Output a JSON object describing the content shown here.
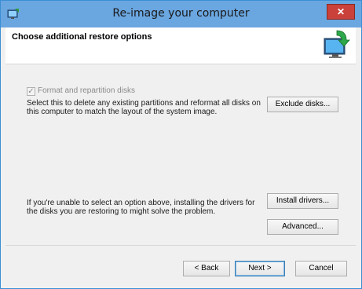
{
  "window": {
    "title": "Re-image your computer",
    "close_label": "✕",
    "title_icon": "restore-computer-icon",
    "colors": {
      "titlebar": "#6aa6e0",
      "close": "#c9413a",
      "border": "#3a8fd6"
    }
  },
  "header": {
    "title": "Choose additional restore options",
    "icon": "computer-restore-icon"
  },
  "options": {
    "format_label": "Format and repartition disks",
    "format_checked": true,
    "format_description": "Select this to delete any existing partitions and reformat all disks on this computer to match the layout of the system image.",
    "exclude_button": "Exclude disks...",
    "drivers_description": "If you're unable to select an option above, installing the drivers for the disks you are restoring to might solve the problem.",
    "install_button": "Install drivers...",
    "advanced_button": "Advanced..."
  },
  "footer": {
    "back_button": "< Back",
    "next_button": "Next >",
    "cancel_button": "Cancel"
  }
}
